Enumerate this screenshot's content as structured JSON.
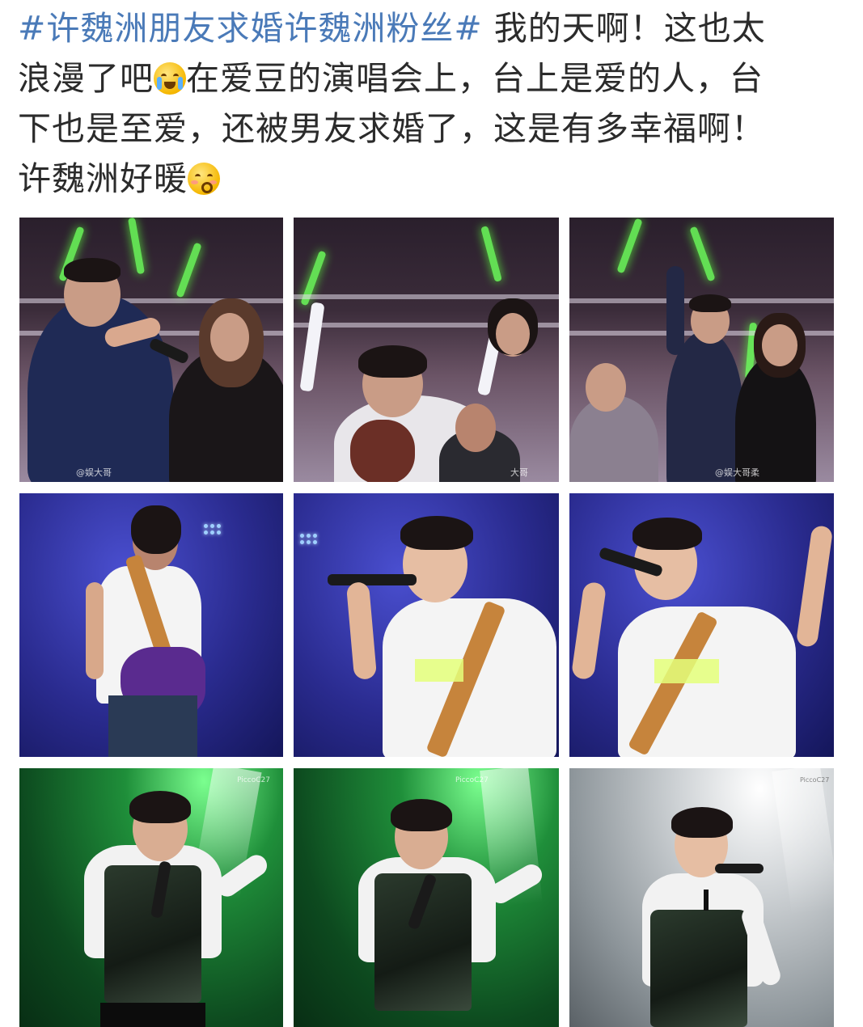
{
  "post": {
    "hashtags": "#许魏洲朋友求婚许魏洲粉丝#",
    "line1_rest": " 我的天啊！这也太",
    "line2_a": "浪漫了吧",
    "line2_b": "在爱豆的演唱会上，台上是爱的人，台",
    "line3": "下也是至爱，还被男友求婚了，这是有多幸福啊！",
    "line4": "许魏洲好暖",
    "emoji_cry": "crying-face-emoji",
    "emoji_kiss": "kissing-face-emoji",
    "hashtag_color": "#4a7ab8"
  },
  "photos": {
    "wm_1": "@娱大哥",
    "wm_2": "大哥",
    "wm_3": "@娱大哥柔",
    "wm_7": "PiccoC27",
    "wm_8": "PiccoC27",
    "wm_9": "PiccoC27"
  }
}
